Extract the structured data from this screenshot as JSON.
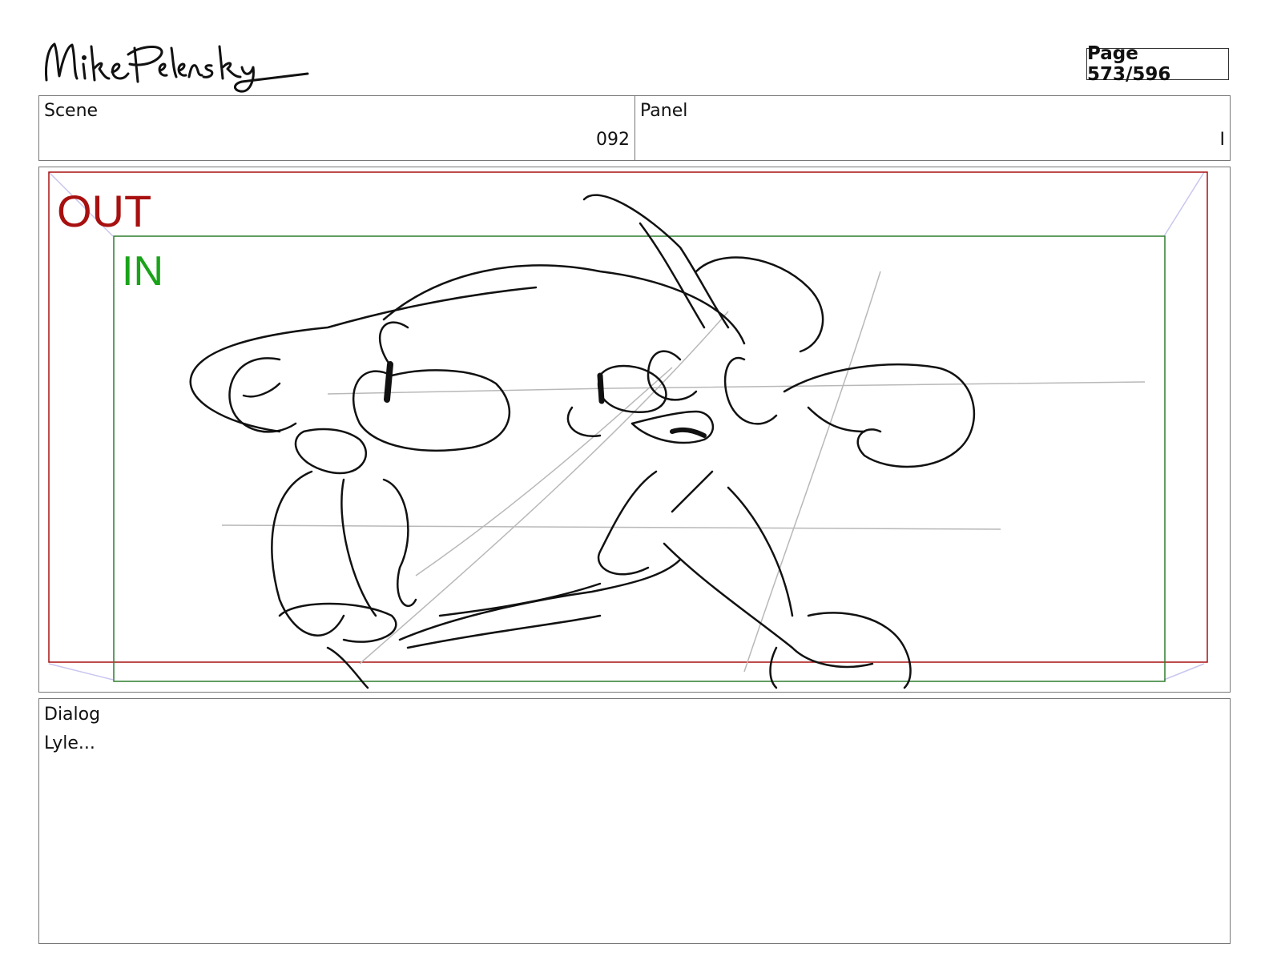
{
  "header": {
    "artist_signature": "Mike Pelensky",
    "page_label": "Page 573/596"
  },
  "scene": {
    "label": "Scene",
    "value": "092"
  },
  "panel": {
    "label": "Panel",
    "value": "I"
  },
  "frame": {
    "out_label": "OUT",
    "in_label": "IN",
    "colors": {
      "out": "#a81010",
      "in": "#1aa31a",
      "sketch": "#111111",
      "guide": "#b8b8b8",
      "corner": "#c9c6f0"
    }
  },
  "dialog": {
    "label": "Dialog",
    "text": "Lyle..."
  }
}
